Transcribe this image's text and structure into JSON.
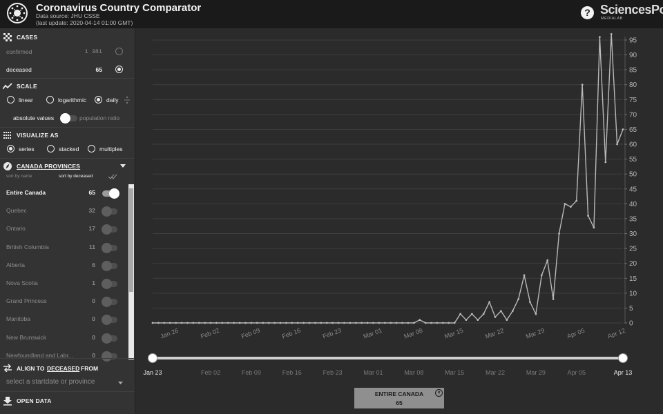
{
  "header": {
    "title": "Coronavirus Country Comparator",
    "data_source": "Data source: JHU CSSE",
    "last_update": "(last update: 2020-04-14 01:00 GMT)",
    "help_label": "?",
    "brand": "SciencesPo",
    "brand_sub": "MEDIALAB",
    "logo_icon": "virus-icon"
  },
  "sidebar": {
    "cases": {
      "title": "CASES",
      "icon": "grid-icon",
      "options": [
        {
          "label": "confirmed",
          "value": "1 381",
          "selected": false
        },
        {
          "label": "deceased",
          "value": "65",
          "selected": true
        }
      ]
    },
    "scale": {
      "title": "SCALE",
      "icon": "trend-line-icon",
      "options": [
        {
          "label": "linear",
          "selected": false
        },
        {
          "label": "logarithmic",
          "selected": false
        },
        {
          "label": "daily",
          "selected": true
        }
      ],
      "absolute_label": "absolute values",
      "ratio_label": "population ratio"
    },
    "visualize": {
      "title": "VISUALIZE AS",
      "icon": "dots-grid-icon",
      "options": [
        {
          "label": "series",
          "selected": true
        },
        {
          "label": "stacked",
          "selected": false
        },
        {
          "label": "multiples",
          "selected": false
        }
      ]
    },
    "provinces": {
      "title": "CANADA PROVINCES",
      "icon": "compass-icon",
      "sort_by_name": "sort by name",
      "sort_by_deceased": "sort by deceased",
      "items": [
        {
          "name": "Entire Canada",
          "count": "65",
          "enabled": true
        },
        {
          "name": "Quebec",
          "count": "32",
          "enabled": false
        },
        {
          "name": "Ontario",
          "count": "17",
          "enabled": false
        },
        {
          "name": "British Columbia",
          "count": "11",
          "enabled": false
        },
        {
          "name": "Alberta",
          "count": "6",
          "enabled": false
        },
        {
          "name": "Nova Scotia",
          "count": "1",
          "enabled": false
        },
        {
          "name": "Grand Princess",
          "count": "0",
          "enabled": false
        },
        {
          "name": "Manitoba",
          "count": "0",
          "enabled": false
        },
        {
          "name": "New Brunswick",
          "count": "0",
          "enabled": false
        },
        {
          "name": "Newfoundland and Labr...",
          "count": "0",
          "enabled": false
        }
      ]
    },
    "align": {
      "prefix": "ALIGN TO",
      "metric": "DECEASED",
      "suffix": "FROM",
      "placeholder": "select a startdate or province"
    },
    "open_data": {
      "label": "OPEN DATA",
      "icon": "download-icon"
    }
  },
  "chart_data": {
    "type": "line",
    "title": "",
    "xlabel": "",
    "ylabel": "",
    "x_tick_labels": [
      "Jan 26",
      "Feb 02",
      "Feb 09",
      "Feb 16",
      "Feb 23",
      "Mar 01",
      "Mar 08",
      "Mar 15",
      "Mar 22",
      "Mar 29",
      "Apr 05",
      "Apr 12"
    ],
    "y_ticks": [
      0,
      5,
      10,
      15,
      20,
      25,
      30,
      35,
      40,
      45,
      50,
      55,
      60,
      65,
      70,
      75,
      80,
      85,
      90,
      95
    ],
    "ylim": [
      0,
      95
    ],
    "x_start": "2020-01-23",
    "x_end": "2020-04-13",
    "grid": true,
    "series": [
      {
        "name": "Entire Canada",
        "color": "#b9b9b9",
        "values": [
          0,
          0,
          0,
          0,
          0,
          0,
          0,
          0,
          0,
          0,
          0,
          0,
          0,
          0,
          0,
          0,
          0,
          0,
          0,
          0,
          0,
          0,
          0,
          0,
          0,
          0,
          0,
          0,
          0,
          0,
          0,
          0,
          0,
          0,
          0,
          0,
          0,
          0,
          0,
          0,
          0,
          0,
          0,
          0,
          0,
          0,
          1,
          0,
          0,
          0,
          0,
          0,
          0,
          3,
          1,
          3,
          1,
          3,
          7,
          2,
          4,
          1,
          4,
          8,
          16,
          7,
          3,
          16,
          21,
          8,
          30,
          40,
          39,
          41,
          80,
          36,
          32,
          96,
          54,
          97,
          60,
          65
        ]
      }
    ]
  },
  "time_slider": {
    "start_label": "Jan 23",
    "end_label": "Apr 13",
    "tick_labels": [
      "Feb 02",
      "Feb 09",
      "Feb 16",
      "Feb 23",
      "Mar 01",
      "Mar 08",
      "Mar 15",
      "Mar 22",
      "Mar 29",
      "Apr 05"
    ]
  },
  "legend": {
    "name": "ENTIRE CANADA",
    "value": "65"
  }
}
